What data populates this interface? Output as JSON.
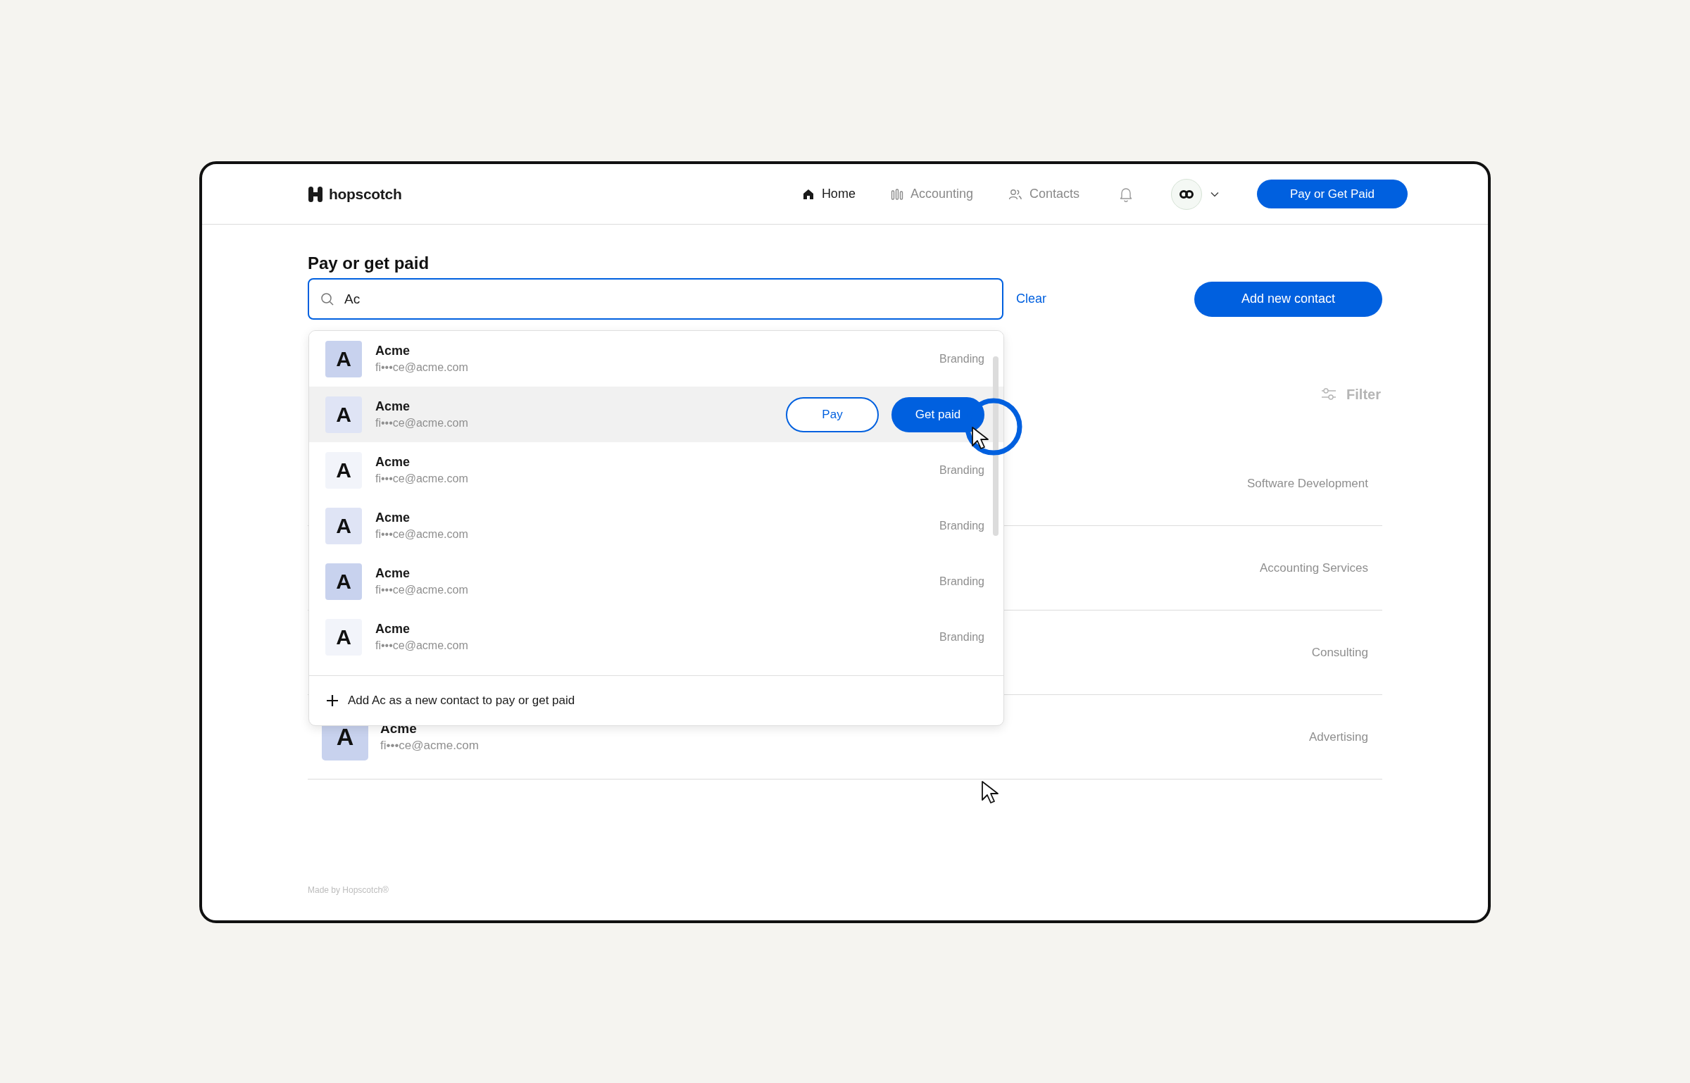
{
  "header": {
    "logo": "hopscotch",
    "nav": [
      {
        "label": "Home",
        "selected": true
      },
      {
        "label": "Accounting",
        "selected": false
      },
      {
        "label": "Contacts",
        "selected": false
      }
    ],
    "cta": "Pay or Get Paid"
  },
  "page": {
    "title": "Pay or get paid",
    "search": {
      "value": "Ac"
    },
    "clear": "Clear",
    "add_button": "Add new contact",
    "filter": {
      "label": "Filter",
      "disabled": true
    }
  },
  "contacts": [
    {
      "tag": "Software Development"
    },
    {
      "tag": "Accounting Services"
    },
    {
      "tag": "Consulting"
    },
    {
      "avatar": "A",
      "name": "Acme",
      "email": "fi•••ce@acme.com",
      "tag": "Advertising",
      "color": "#c8d2ee"
    }
  ],
  "dropdown": {
    "results": [
      {
        "avatar": "A",
        "name": "Acme",
        "email": "fi•••ce@acme.com",
        "tag": "Branding",
        "color": "#c8d2ee",
        "highlighted": false
      },
      {
        "avatar": "A",
        "name": "Acme",
        "email": "fi•••ce@acme.com",
        "color": "#dfe4f5",
        "highlighted": true,
        "actions": [
          {
            "label": "Pay",
            "kind": "outline"
          },
          {
            "label": "Get paid",
            "kind": "filled"
          }
        ]
      },
      {
        "avatar": "A",
        "name": "Acme",
        "email": "fi•••ce@acme.com",
        "tag": "Branding",
        "color": "#f2f4fa",
        "highlighted": false
      },
      {
        "avatar": "A",
        "name": "Acme",
        "email": "fi•••ce@acme.com",
        "tag": "Branding",
        "color": "#dfe4f5",
        "highlighted": false
      },
      {
        "avatar": "A",
        "name": "Acme",
        "email": "fi•••ce@acme.com",
        "tag": "Branding",
        "color": "#c8d2ee",
        "highlighted": false
      },
      {
        "avatar": "A",
        "name": "Acme",
        "email": "fi•••ce@acme.com",
        "tag": "Branding",
        "color": "#f2f4fa",
        "highlighted": false
      }
    ],
    "add_option": "Add Ac as a new contact to pay or get paid"
  },
  "footer": "Made by Hopscotch®"
}
